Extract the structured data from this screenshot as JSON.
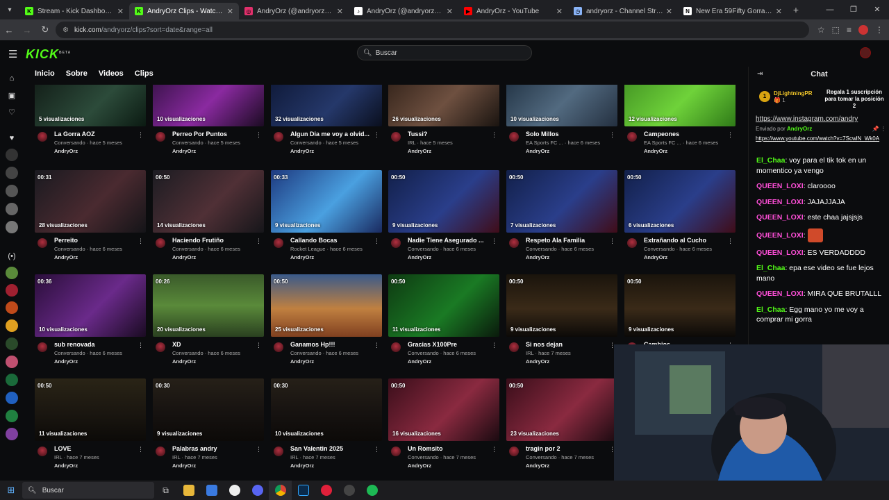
{
  "browser": {
    "tabs": [
      {
        "title": "Stream - Kick Dashboard",
        "color": "#53fc18",
        "glyph": "K",
        "active": false
      },
      {
        "title": "AndryOrz Clips - Watch Live",
        "color": "#53fc18",
        "glyph": "K",
        "active": true
      },
      {
        "title": "AndryOrz (@andryorz7) • Fotos",
        "color": "#e1306c",
        "glyph": "◎",
        "active": false
      },
      {
        "title": "AndryOrz (@andryorz7) | TikTok",
        "color": "#ffffff",
        "glyph": "♪",
        "active": false
      },
      {
        "title": "AndryOrz - YouTube",
        "color": "#ff0000",
        "glyph": "▶",
        "active": false
      },
      {
        "title": "andryorz - Channel Streams on",
        "color": "#8ab4f8",
        "glyph": "◷",
        "active": false
      },
      {
        "title": "New Era 59Fifty Gorra MLB Bas",
        "color": "#ffffff",
        "glyph": "N",
        "active": false
      }
    ],
    "url_host": "kick.com",
    "url_path": "/andryorz/clips?sort=date&range=all"
  },
  "kick": {
    "logo": "KICK",
    "logo_beta": "BETA",
    "search_placeholder": "Buscar",
    "channel_tabs": [
      "Inicio",
      "Sobre",
      "Videos",
      "Clips"
    ]
  },
  "clips": [
    {
      "title": "La Gorra AOZ",
      "duration": "",
      "views": "5 visualizaciones",
      "category": "Conversando",
      "age": "hace 5 meses",
      "author": "AndryOrz",
      "bg": "linear-gradient(135deg,#0e1612,#2c4b3a 60%,#0b1a12)"
    },
    {
      "title": "Perreo Por Puntos",
      "duration": "",
      "views": "10 visualizaciones",
      "category": "Conversando",
      "age": "hace 5 meses",
      "author": "AndryOrz",
      "bg": "linear-gradient(135deg,#2a0e3a,#8a2aa0 55%,#1b0b22)"
    },
    {
      "title": "Algun Dia me voy a olvid...",
      "duration": "",
      "views": "32 visualizaciones",
      "category": "Conversando",
      "age": "hace 5 meses",
      "author": "AndryOrz",
      "bg": "linear-gradient(135deg,#0b1430,#25386a 60%,#0a0f1e)"
    },
    {
      "title": "Tussi?",
      "duration": "",
      "views": "26 visualizaciones",
      "category": "IRL",
      "age": "hace 5 meses",
      "author": "AndryOrz",
      "bg": "linear-gradient(135deg,#2a1c14,#6e5040 55%,#1a1410)"
    },
    {
      "title": "Solo Millos",
      "duration": "",
      "views": "10 visualizaciones",
      "category": "EA Sports FC ...",
      "age": "hace 6 meses",
      "author": "AndryOrz",
      "bg": "linear-gradient(135deg,#1a2a3a,#526a80 55%,#243040)"
    },
    {
      "title": "Campeones",
      "duration": "",
      "views": "12 visualizaciones",
      "category": "EA Sports FC ...",
      "age": "hace 6 meses",
      "author": "AndryOrz",
      "bg": "linear-gradient(135deg,#3c8a20,#6fd23a 55%,#2f7a18)"
    },
    {
      "title": "Perreito",
      "duration": "00:31",
      "views": "28 visualizaciones",
      "category": "Conversando",
      "age": "hace 6 meses",
      "author": "AndryOrz",
      "bg": "linear-gradient(135deg,#1a1a20,#4a2a30 55%,#141418)"
    },
    {
      "title": "Haciendo Frutiño",
      "duration": "00:50",
      "views": "14 visualizaciones",
      "category": "Conversando",
      "age": "hace 6 meses",
      "author": "AndryOrz",
      "bg": "linear-gradient(135deg,#1c1c22,#503036 55%,#16161a)"
    },
    {
      "title": "Callando Bocas",
      "duration": "00:33",
      "views": "9 visualizaciones",
      "category": "Rocket League",
      "age": "hace 6 meses",
      "author": "AndryOrz",
      "bg": "linear-gradient(135deg,#1e3a80,#4aa0e0 55%,#1a2a60)"
    },
    {
      "title": "Nadie Tiene Asegurado ...",
      "duration": "00:50",
      "views": "9 visualizaciones",
      "category": "Conversando",
      "age": "hace 6 meses",
      "author": "AndryOrz",
      "bg": "linear-gradient(135deg,#12204a,#2a3e8a 55%,#400c18)"
    },
    {
      "title": "Respeto Ala Familia",
      "duration": "00:50",
      "views": "7 visualizaciones",
      "category": "Conversando",
      "age": "hace 6 meses",
      "author": "AndryOrz",
      "bg": "linear-gradient(135deg,#12204a,#2a3e8a 55%,#400c18)"
    },
    {
      "title": "Extrañando al Cucho",
      "duration": "00:50",
      "views": "6 visualizaciones",
      "category": "Conversando",
      "age": "hace 6 meses",
      "author": "AndryOrz",
      "bg": "linear-gradient(135deg,#12204a,#2a3e8a 55%,#400c18)"
    },
    {
      "title": "sub renovada",
      "duration": "00:36",
      "views": "10 visualizaciones",
      "category": "Conversando",
      "age": "hace 6 meses",
      "author": "AndryOrz",
      "bg": "linear-gradient(135deg,#2a0e3a,#6a2a8a 55%,#1a0b22)"
    },
    {
      "title": "XD",
      "duration": "00:26",
      "views": "20 visualizaciones",
      "category": "Conversando",
      "age": "hace 6 meses",
      "author": "AndryOrz",
      "bg": "linear-gradient(180deg,#3a5a2a,#5a8a3a 50%,#2a4020)"
    },
    {
      "title": "Ganamos Hp!!!",
      "duration": "00:50",
      "views": "25 visualizaciones",
      "category": "Conversando",
      "age": "hace 6 meses",
      "author": "AndryOrz",
      "bg": "linear-gradient(180deg,#3a5a8a,#c08040 55%,#804020)"
    },
    {
      "title": "Gracias X100Pre",
      "duration": "00:50",
      "views": "11 visualizaciones",
      "category": "Conversando",
      "age": "hace 6 meses",
      "author": "AndryOrz",
      "bg": "linear-gradient(135deg,#0e3a12,#1a7a24 55%,#0a1a0c)"
    },
    {
      "title": "Si nos dejan",
      "duration": "00:50",
      "views": "9 visualizaciones",
      "category": "IRL",
      "age": "hace 7 meses",
      "author": "AndryOrz",
      "bg": "linear-gradient(180deg,#1a140c,#3a2a18 55%,#0c0a08)"
    },
    {
      "title": "Cambios",
      "duration": "00:50",
      "views": "9 visualizaciones",
      "category": "IRL",
      "age": "hace 7 meses",
      "author": "AndryOrz",
      "bg": "linear-gradient(180deg,#1a140c,#3a2a18 55%,#0c0a08)"
    },
    {
      "title": "LOVE",
      "duration": "00:50",
      "views": "11 visualizaciones",
      "category": "IRL",
      "age": "hace 7 meses",
      "author": "AndryOrz",
      "bg": "linear-gradient(180deg,#2a2416,#1a1610 55%,#0c0a08)"
    },
    {
      "title": "Palabras andry",
      "duration": "00:30",
      "views": "9 visualizaciones",
      "category": "IRL",
      "age": "hace 7 meses",
      "author": "AndryOrz",
      "bg": "linear-gradient(180deg,#262018,#161210 55%,#0c0a08)"
    },
    {
      "title": "San Valentin 2025",
      "duration": "00:30",
      "views": "10 visualizaciones",
      "category": "IRL",
      "age": "hace 7 meses",
      "author": "AndryOrz",
      "bg": "linear-gradient(180deg,#262018,#161210 55%,#0c0a08)"
    },
    {
      "title": "Un Romsito",
      "duration": "00:50",
      "views": "16 visualizaciones",
      "category": "Conversando",
      "age": "hace 7 meses",
      "author": "AndryOrz",
      "bg": "linear-gradient(135deg,#3a0e1a,#8a2a40 55%,#1a0a10)"
    },
    {
      "title": "tragin por 2",
      "duration": "00:50",
      "views": "23 visualizaciones",
      "category": "Conversando",
      "age": "hace 7 meses",
      "author": "AndryOrz",
      "bg": "linear-gradient(135deg,#3a0e1a,#8a2a40 55%,#1a0a10)"
    }
  ],
  "chat": {
    "title": "Chat",
    "pin_user": "DjLightningPR",
    "pin_count": "1",
    "pin_gift": "Regala 1 suscripción para tomar la posición 2",
    "pinned_top": "https://www.instagram.com/andry",
    "pinned_by_label": "Enviado por",
    "pinned_by_user": "AndryOrz",
    "pinned_link": "https://www.youtube.com/watch?v=7ScwlN_Wk0A",
    "messages": [
      {
        "user": "El_Chaa",
        "text": "voy para el tik tok en un momentico ya vengo",
        "color": "#53fc18"
      },
      {
        "user": "QUEEN_LOXI",
        "text": "claroooo",
        "color": "#ff4fd8"
      },
      {
        "user": "QUEEN_LOXI",
        "text": "JAJAJJAJA",
        "color": "#ff4fd8"
      },
      {
        "user": "QUEEN_LOXI",
        "text": "este chaa jajsjsjs",
        "color": "#ff4fd8"
      },
      {
        "user": "QUEEN_LOXI",
        "text": "",
        "color": "#ff4fd8",
        "emote": true
      },
      {
        "user": "QUEEN_LOXI",
        "text": "ES VERDADDDD",
        "color": "#ff4fd8"
      },
      {
        "user": "El_Chaa",
        "text": "epa ese video se fue lejos mano",
        "color": "#53fc18"
      },
      {
        "user": "QUEEN_LOXI",
        "text": "MIRA QUE BRUTALLL",
        "color": "#ff4fd8"
      },
      {
        "user": "El_Chaa",
        "text": "Egg mano yo me voy a comprar mi gorra",
        "color": "#53fc18"
      }
    ]
  },
  "taskbar": {
    "search_label": "Buscar"
  }
}
